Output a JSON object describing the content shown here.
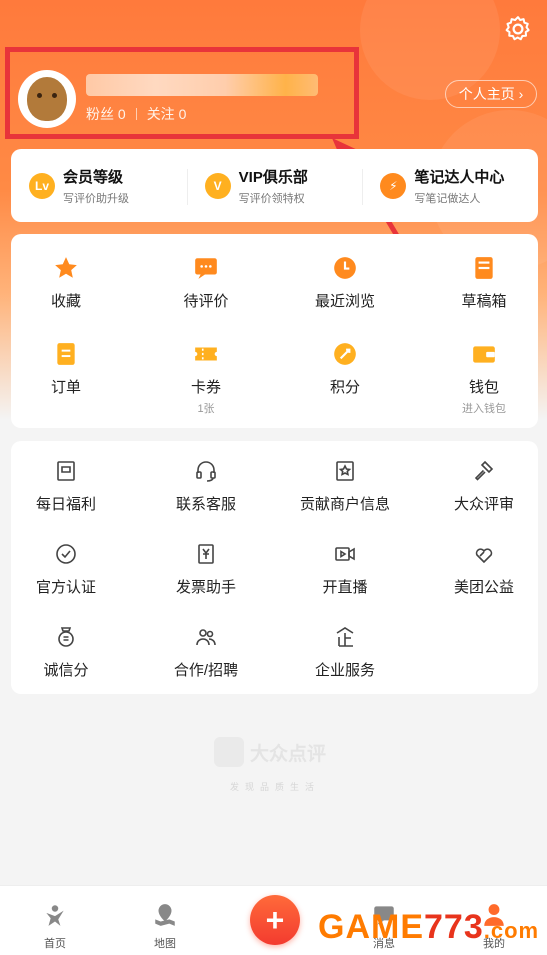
{
  "profile": {
    "followers_label": "粉丝 0",
    "following_label": "关注 0",
    "home_button": "个人主页 ›"
  },
  "vip_row": [
    {
      "badge": "Lv",
      "title": "会员等级",
      "sub": "写评价助升级"
    },
    {
      "badge": "V",
      "title": "VIP俱乐部",
      "sub": "写评价领特权"
    },
    {
      "badge": "⚡",
      "title": "笔记达人中心",
      "sub": "写笔记做达人"
    }
  ],
  "grid1": [
    {
      "label": "收藏",
      "icon": "star-icon"
    },
    {
      "label": "待评价",
      "icon": "comment-icon"
    },
    {
      "label": "最近浏览",
      "icon": "clock-icon"
    },
    {
      "label": "草稿箱",
      "icon": "draft-icon"
    },
    {
      "label": "订单",
      "icon": "order-icon"
    },
    {
      "label": "卡券",
      "icon": "coupon-icon",
      "hint": "1张"
    },
    {
      "label": "积分",
      "icon": "points-icon"
    },
    {
      "label": "钱包",
      "icon": "wallet-icon",
      "hint": "进入钱包"
    }
  ],
  "grid2": [
    {
      "label": "每日福利",
      "icon": "gift-icon"
    },
    {
      "label": "联系客服",
      "icon": "headset-icon"
    },
    {
      "label": "贡献商户信息",
      "icon": "store-icon"
    },
    {
      "label": "大众评审",
      "icon": "gavel-icon"
    },
    {
      "label": "官方认证",
      "icon": "check-circle-icon"
    },
    {
      "label": "发票助手",
      "icon": "invoice-icon"
    },
    {
      "label": "开直播",
      "icon": "live-icon"
    },
    {
      "label": "美团公益",
      "icon": "heart-hands-icon"
    },
    {
      "label": "诚信分",
      "icon": "credit-icon"
    },
    {
      "label": "合作/招聘",
      "icon": "people-icon"
    },
    {
      "label": "企业服务",
      "icon": "enterprise-icon"
    }
  ],
  "footer_logo": {
    "name": "大众点评",
    "slogan": "发现品质生活"
  },
  "tabs": [
    {
      "label": "首页",
      "icon": "home-icon"
    },
    {
      "label": "地图",
      "icon": "map-icon"
    },
    {
      "label": "+",
      "icon": "add-icon"
    },
    {
      "label": "消息",
      "icon": "message-icon"
    },
    {
      "label": "我的",
      "icon": "profile-icon"
    }
  ],
  "watermark": {
    "g": "G",
    "a": "AME",
    "n": "773",
    "c": ".com"
  },
  "colors": {
    "accent": "#ff7a3c",
    "icon_orange": "#ff8a1e",
    "annotation_red": "#e8343a"
  }
}
